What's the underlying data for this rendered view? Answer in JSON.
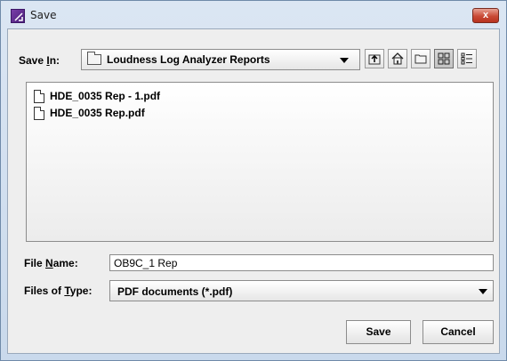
{
  "window": {
    "title": "Save",
    "close_label": "x"
  },
  "save_in": {
    "label_prefix": "Save ",
    "label_accel": "I",
    "label_suffix": "n:",
    "value": "Loudness Log Analyzer Reports"
  },
  "toolbar": {
    "buttons": [
      "up-one-level",
      "home",
      "new-folder",
      "list-view",
      "details-view"
    ],
    "selected": "list-view"
  },
  "files": [
    {
      "name": "HDE_0035 Rep - 1.pdf",
      "icon": "document-icon"
    },
    {
      "name": "HDE_0035 Rep.pdf",
      "icon": "document-icon"
    }
  ],
  "file_name": {
    "label_prefix": "File ",
    "label_accel": "N",
    "label_suffix": "ame:",
    "value": "OB9C_1 Rep"
  },
  "file_type": {
    "label_prefix": "Files of ",
    "label_accel": "T",
    "label_suffix": "ype:",
    "value": "PDF documents (*.pdf)"
  },
  "actions": {
    "save_label": "Save",
    "cancel_label": "Cancel"
  },
  "colors": {
    "title_gradient_top": "#dbe6f3",
    "close_red": "#c94a36",
    "app_icon_purple": "#7a3fa8"
  }
}
